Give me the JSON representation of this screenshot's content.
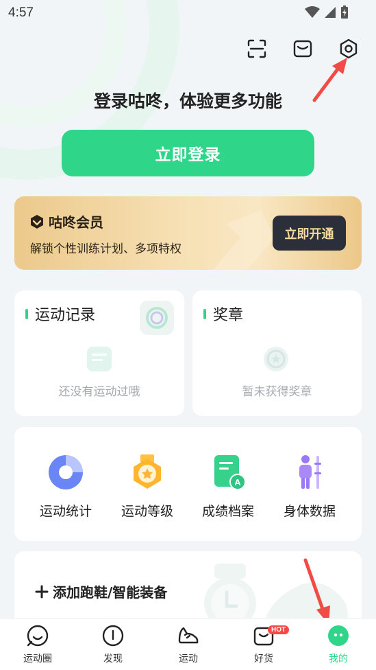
{
  "status_bar": {
    "time": "4:57"
  },
  "header": {
    "login_prompt": "登录咕咚，体验更多功能",
    "login_button": "立即登录",
    "icons": [
      "scan-icon",
      "mail-icon",
      "settings-icon"
    ]
  },
  "membership": {
    "title": "咕咚会员",
    "description": "解锁个性训练计划、多项特权",
    "button": "立即开通"
  },
  "records": {
    "title": "运动记录",
    "empty_text": "还没有运动过哦"
  },
  "medals": {
    "title": "奖章",
    "empty_text": "暂未获得奖章"
  },
  "tools": [
    {
      "label": "运动统计",
      "icon": "pie-chart-icon"
    },
    {
      "label": "运动等级",
      "icon": "badge-icon"
    },
    {
      "label": "成绩档案",
      "icon": "document-icon"
    },
    {
      "label": "身体数据",
      "icon": "body-icon"
    }
  ],
  "device": {
    "label": "添加跑鞋/智能装备"
  },
  "bottom_nav": [
    {
      "label": "运动圈",
      "icon": "smile-icon",
      "active": false
    },
    {
      "label": "发现",
      "icon": "compass-icon",
      "active": false
    },
    {
      "label": "运动",
      "icon": "shoe-icon",
      "active": false
    },
    {
      "label": "好货",
      "icon": "bag-icon",
      "active": false,
      "badge": "HOT"
    },
    {
      "label": "我的",
      "icon": "profile-icon",
      "active": true
    }
  ],
  "colors": {
    "accent": "#2fd68a",
    "member_gold": "#f2d49c",
    "arrow_red": "#f24b47",
    "hot_badge": "#f24b47"
  }
}
